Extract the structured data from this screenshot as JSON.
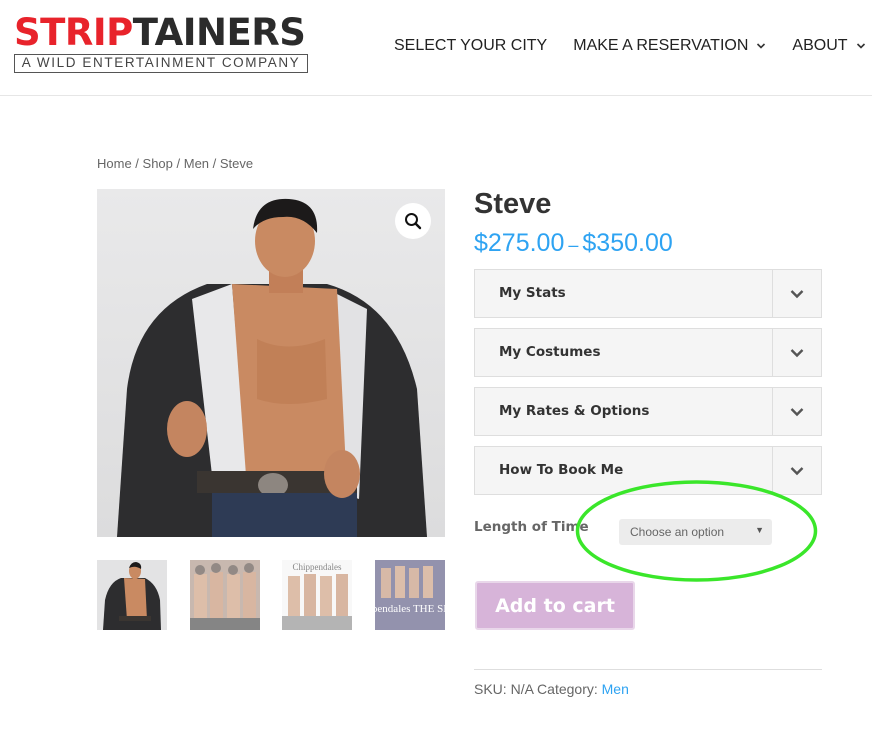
{
  "brand": {
    "name_part1": "STRIP",
    "name_part2": "TAINERS",
    "tagline": "A WILD ENTERTAINMENT COMPANY",
    "accent_color": "#e8232b"
  },
  "nav": {
    "items": [
      {
        "label": "SELECT YOUR CITY",
        "has_dropdown": false
      },
      {
        "label": "MAKE A RESERVATION",
        "has_dropdown": true
      },
      {
        "label": "ABOUT",
        "has_dropdown": true
      }
    ]
  },
  "breadcrumb": {
    "home": "Home",
    "shop": "Shop",
    "category": "Men",
    "current": "Steve",
    "separator": " / "
  },
  "product": {
    "title": "Steve",
    "price_min": "$275.00",
    "price_sep": "–",
    "price_max": "$350.00",
    "price_color": "#2ea3f2",
    "accordions": [
      {
        "label": "My Stats"
      },
      {
        "label": "My Costumes"
      },
      {
        "label": "My Rates & Options"
      },
      {
        "label": "How To Book Me"
      }
    ],
    "variation_label": "Length of Time",
    "select_value": "Choose an option",
    "add_to_cart": "Add to cart",
    "sku_label": "SKU:",
    "sku_value": "N/A",
    "category_label": "Category:",
    "category_value": "Men"
  },
  "gallery": {
    "zoom_icon": "magnifier-icon",
    "thumb_texts": [
      "Chippendales",
      "Chippendales THE SHOW"
    ]
  }
}
